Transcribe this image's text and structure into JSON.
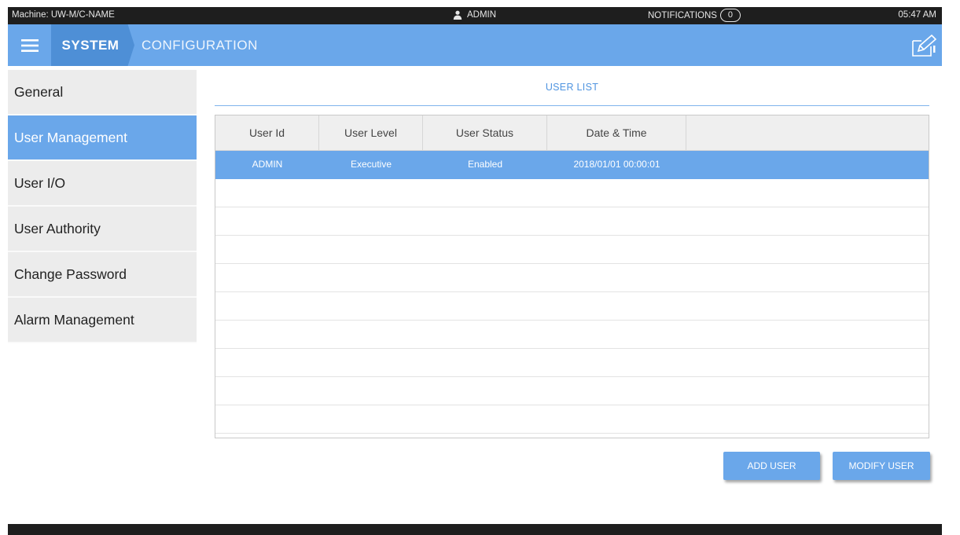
{
  "statusbar": {
    "machine": "Machine: UW-M/C-NAME",
    "user": "ADMIN",
    "notifications_label": "NOTIFICATIONS",
    "notifications_count": "0",
    "time": "05:47 AM"
  },
  "header": {
    "breadcrumb_system": "SYSTEM",
    "breadcrumb_page": "CONFIGURATION"
  },
  "sidebar": {
    "items": [
      {
        "label": "General"
      },
      {
        "label": "User Management"
      },
      {
        "label": "User I/O"
      },
      {
        "label": "User Authority"
      },
      {
        "label": "Change Password"
      },
      {
        "label": "Alarm Management"
      }
    ],
    "active_index": 1
  },
  "main": {
    "title": "USER LIST",
    "columns": [
      "User Id",
      "User Level",
      "User Status",
      "Date & Time",
      ""
    ],
    "rows": [
      {
        "user_id": "ADMIN",
        "user_level": "Executive",
        "user_status": "Enabled",
        "date_time": "2018/01/01 00:00:01"
      }
    ],
    "add_button": "ADD USER",
    "modify_button": "MODIFY USER"
  },
  "colors": {
    "accent": "#6aa7ea",
    "accent_dark": "#4e8fd6",
    "statusbar": "#1e1e1e",
    "sidebar_bg": "#ececec"
  },
  "icons": {
    "menu": "hamburger-icon",
    "user": "user-icon",
    "edit": "edit-icon"
  }
}
